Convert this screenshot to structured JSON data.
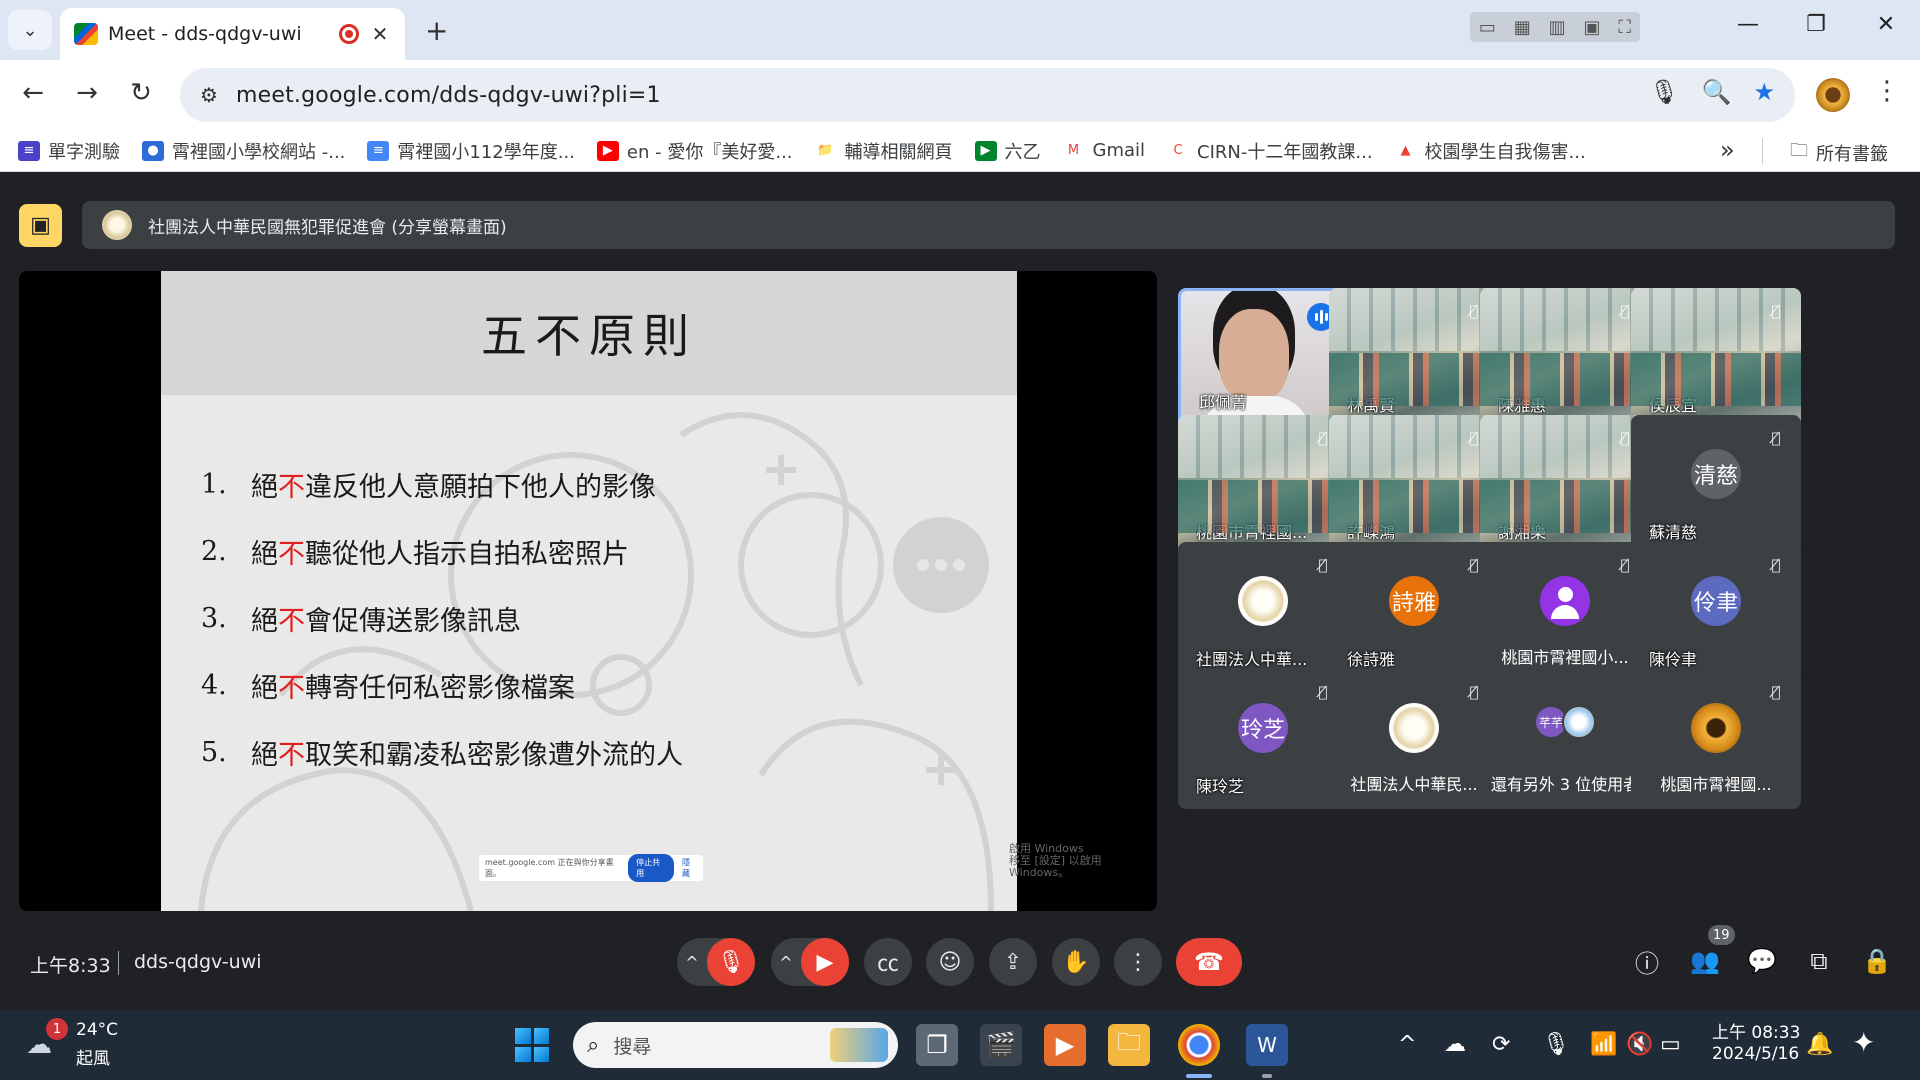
{
  "browser": {
    "tab_title": "Meet - dds-qdgv-uwi",
    "url": "meet.google.com/dds-qdgv-uwi?pli=1",
    "bookmarks": [
      {
        "label": "單字測驗",
        "color": "#4a42c9",
        "glyph": "≡"
      },
      {
        "label": "霄裡國小學校網站 -...",
        "color": "#2e6bd6",
        "glyph": "●"
      },
      {
        "label": "霄裡國小112學年度...",
        "color": "#4285f4",
        "glyph": "≡"
      },
      {
        "label": "en - 愛你『美好愛...",
        "color": "#ff0000",
        "glyph": "▶"
      },
      {
        "label": "輔導相關網頁",
        "color": "#ffffff",
        "glyph": "📁"
      },
      {
        "label": "六乙",
        "color": "#00832d",
        "glyph": "▶"
      },
      {
        "label": "Gmail",
        "color": "#ffffff",
        "glyph": "M"
      },
      {
        "label": "CIRN-十二年國教課...",
        "color": "#ffffff",
        "glyph": "C"
      },
      {
        "label": "校園學生自我傷害...",
        "color": "#ffffff",
        "glyph": "▲"
      }
    ],
    "more_bookmarks": "»",
    "all_bookmarks": "所有書籤"
  },
  "meet": {
    "presenting_banner": "社團法人中華民國無犯罪促進會 (分享螢幕畫面)",
    "slide": {
      "title": "五不原則",
      "rules": [
        {
          "num": "1.",
          "pre": "絕",
          "red": "不",
          "post": "違反他人意願拍下他人的影像"
        },
        {
          "num": "2.",
          "pre": "絕",
          "red": "不",
          "post": "聽從他人指示自拍私密照片"
        },
        {
          "num": "3.",
          "pre": "絕",
          "red": "不",
          "post": "會促傳送影像訊息"
        },
        {
          "num": "4.",
          "pre": "絕",
          "red": "不",
          "post": "轉寄任何私密影像檔案"
        },
        {
          "num": "5.",
          "pre": "絕",
          "red": "不",
          "post": "取笑和霸凌私密影像遭外流的人"
        }
      ],
      "share_notice": "meet.google.com 正在與你分享畫面。",
      "share_stop": "停止共用",
      "share_hide": "隱藏",
      "activate_1": "啟用 Windows",
      "activate_2": "移至 [設定] 以啟用 Windows。"
    },
    "participants": [
      {
        "name": "邱佩菁",
        "kind": "face"
      },
      {
        "name": "林禹賢",
        "kind": "photo"
      },
      {
        "name": "陳雅惠",
        "kind": "photo"
      },
      {
        "name": "侯辰宜",
        "kind": "photo"
      },
      {
        "name": "桃園市霄裡國...",
        "kind": "photo"
      },
      {
        "name": "許嶸鴻",
        "kind": "photo"
      },
      {
        "name": "謝湘樂",
        "kind": "photo"
      },
      {
        "name": "蘇清慈",
        "kind": "avatar",
        "initials": "清慈",
        "color": "#5f6368"
      },
      {
        "name": "社團法人中華...",
        "kind": "avatar-logo"
      },
      {
        "name": "徐詩雅",
        "kind": "avatar",
        "initials": "詩雅",
        "color": "#e8710a"
      },
      {
        "name": "桃園市霄裡國小...",
        "kind": "avatar-person"
      },
      {
        "name": "陳伶聿",
        "kind": "avatar",
        "initials": "伶聿",
        "color": "#5c6bc0"
      },
      {
        "name": "陳玲芝",
        "kind": "avatar",
        "initials": "玲芝",
        "color": "#7e57c2"
      },
      {
        "name": "社團法人中華民...",
        "kind": "avatar-logo-center"
      },
      {
        "name": "還有另外 3 位使用者",
        "kind": "more",
        "initials": "芊芊"
      },
      {
        "name": "桃園市霄裡國...",
        "kind": "avatar-sun"
      }
    ],
    "time": "上午8:33",
    "meeting_code": "dds-qdgv-uwi",
    "people_count": "19"
  },
  "taskbar": {
    "weather_temp": "24°C",
    "weather_desc": "起風",
    "weather_badge": "1",
    "search_placeholder": "搜尋",
    "clock_time": "上午 08:33",
    "clock_date": "2024/5/16"
  },
  "colors": {
    "meet_bg": "#202124",
    "accent_blue": "#1a73e8",
    "hangup_red": "#ea4335",
    "presenting_yellow": "#fdd663"
  }
}
